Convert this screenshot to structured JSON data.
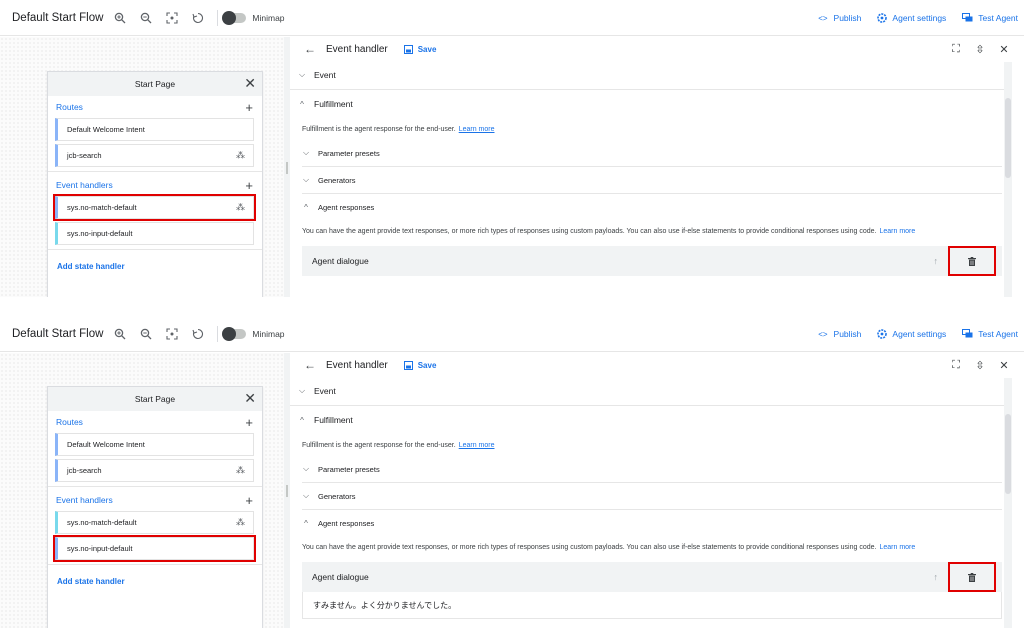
{
  "toolbar": {
    "flow_title": "Default Start Flow",
    "minimap_label": "Minimap",
    "publish_label": "Publish",
    "agent_settings_label": "Agent settings",
    "test_agent_label": "Test Agent"
  },
  "start_page": {
    "title": "Start Page",
    "routes_label": "Routes",
    "routes": [
      "Default Welcome Intent",
      "jcb-search"
    ],
    "event_handlers_label": "Event handlers",
    "event_handlers": [
      "sys.no-match-default",
      "sys.no-input-default"
    ],
    "add_state_handler_label": "Add state handler"
  },
  "event_handler": {
    "title": "Event handler",
    "save_label": "Save",
    "event_label": "Event",
    "fulfillment_label": "Fulfillment",
    "fulfillment_desc": "Fulfillment is the agent response for the end-user.",
    "learn_more": "Learn more",
    "parameter_presets_label": "Parameter presets",
    "generators_label": "Generators",
    "agent_responses_label": "Agent responses",
    "agent_responses_desc": "You can have the agent provide text responses, or more rich types of responses using custom payloads. You can also use if-else statements to provide conditional responses using code.",
    "agent_dialogue_label": "Agent dialogue",
    "dialogue_text": "すみません。よく分かりませんでした。"
  },
  "colors": {
    "accent": "#1a73e8",
    "highlight": "#e00000"
  }
}
